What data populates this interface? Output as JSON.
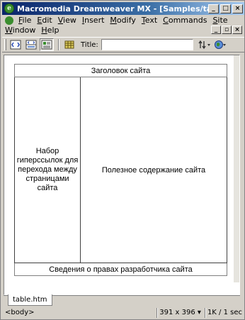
{
  "window": {
    "title": "Macromedia Dreamweaver MX - [Samples/table.htm]",
    "app_icon_letter": "e",
    "minimize": "_",
    "maximize": "□",
    "close": "×"
  },
  "menu": {
    "items": [
      {
        "label": "File",
        "accel": "F",
        "rest": "ile"
      },
      {
        "label": "Edit",
        "accel": "E",
        "rest": "dit"
      },
      {
        "label": "View",
        "accel": "V",
        "rest": "iew"
      },
      {
        "label": "Insert",
        "accel": "I",
        "rest": "nsert"
      },
      {
        "label": "Modify",
        "accel": "M",
        "rest": "odify"
      },
      {
        "label": "Text",
        "accel": "T",
        "rest": "ext"
      },
      {
        "label": "Commands",
        "accel": "C",
        "rest": "ommands"
      },
      {
        "label": "Site",
        "accel": "S",
        "rest": "ite"
      },
      {
        "label": "Window",
        "accel": "W",
        "rest": "indow"
      },
      {
        "label": "Help",
        "accel": "H",
        "rest": "elp"
      }
    ],
    "doc_minimize": "_",
    "doc_restore": "▫",
    "doc_close": "×"
  },
  "toolbar": {
    "title_label": "Title:",
    "title_value": ""
  },
  "page": {
    "header": "Заголовок сайта",
    "nav": "Набор гиперссылок для перехода между страницами сайта",
    "content": "Полезное содержание сайта",
    "footer": "Сведения о правах разработчика сайта"
  },
  "tab": {
    "label": "table.htm"
  },
  "status": {
    "tag": "<body>",
    "size": "391 x 396",
    "download": "1K / 1 sec"
  }
}
